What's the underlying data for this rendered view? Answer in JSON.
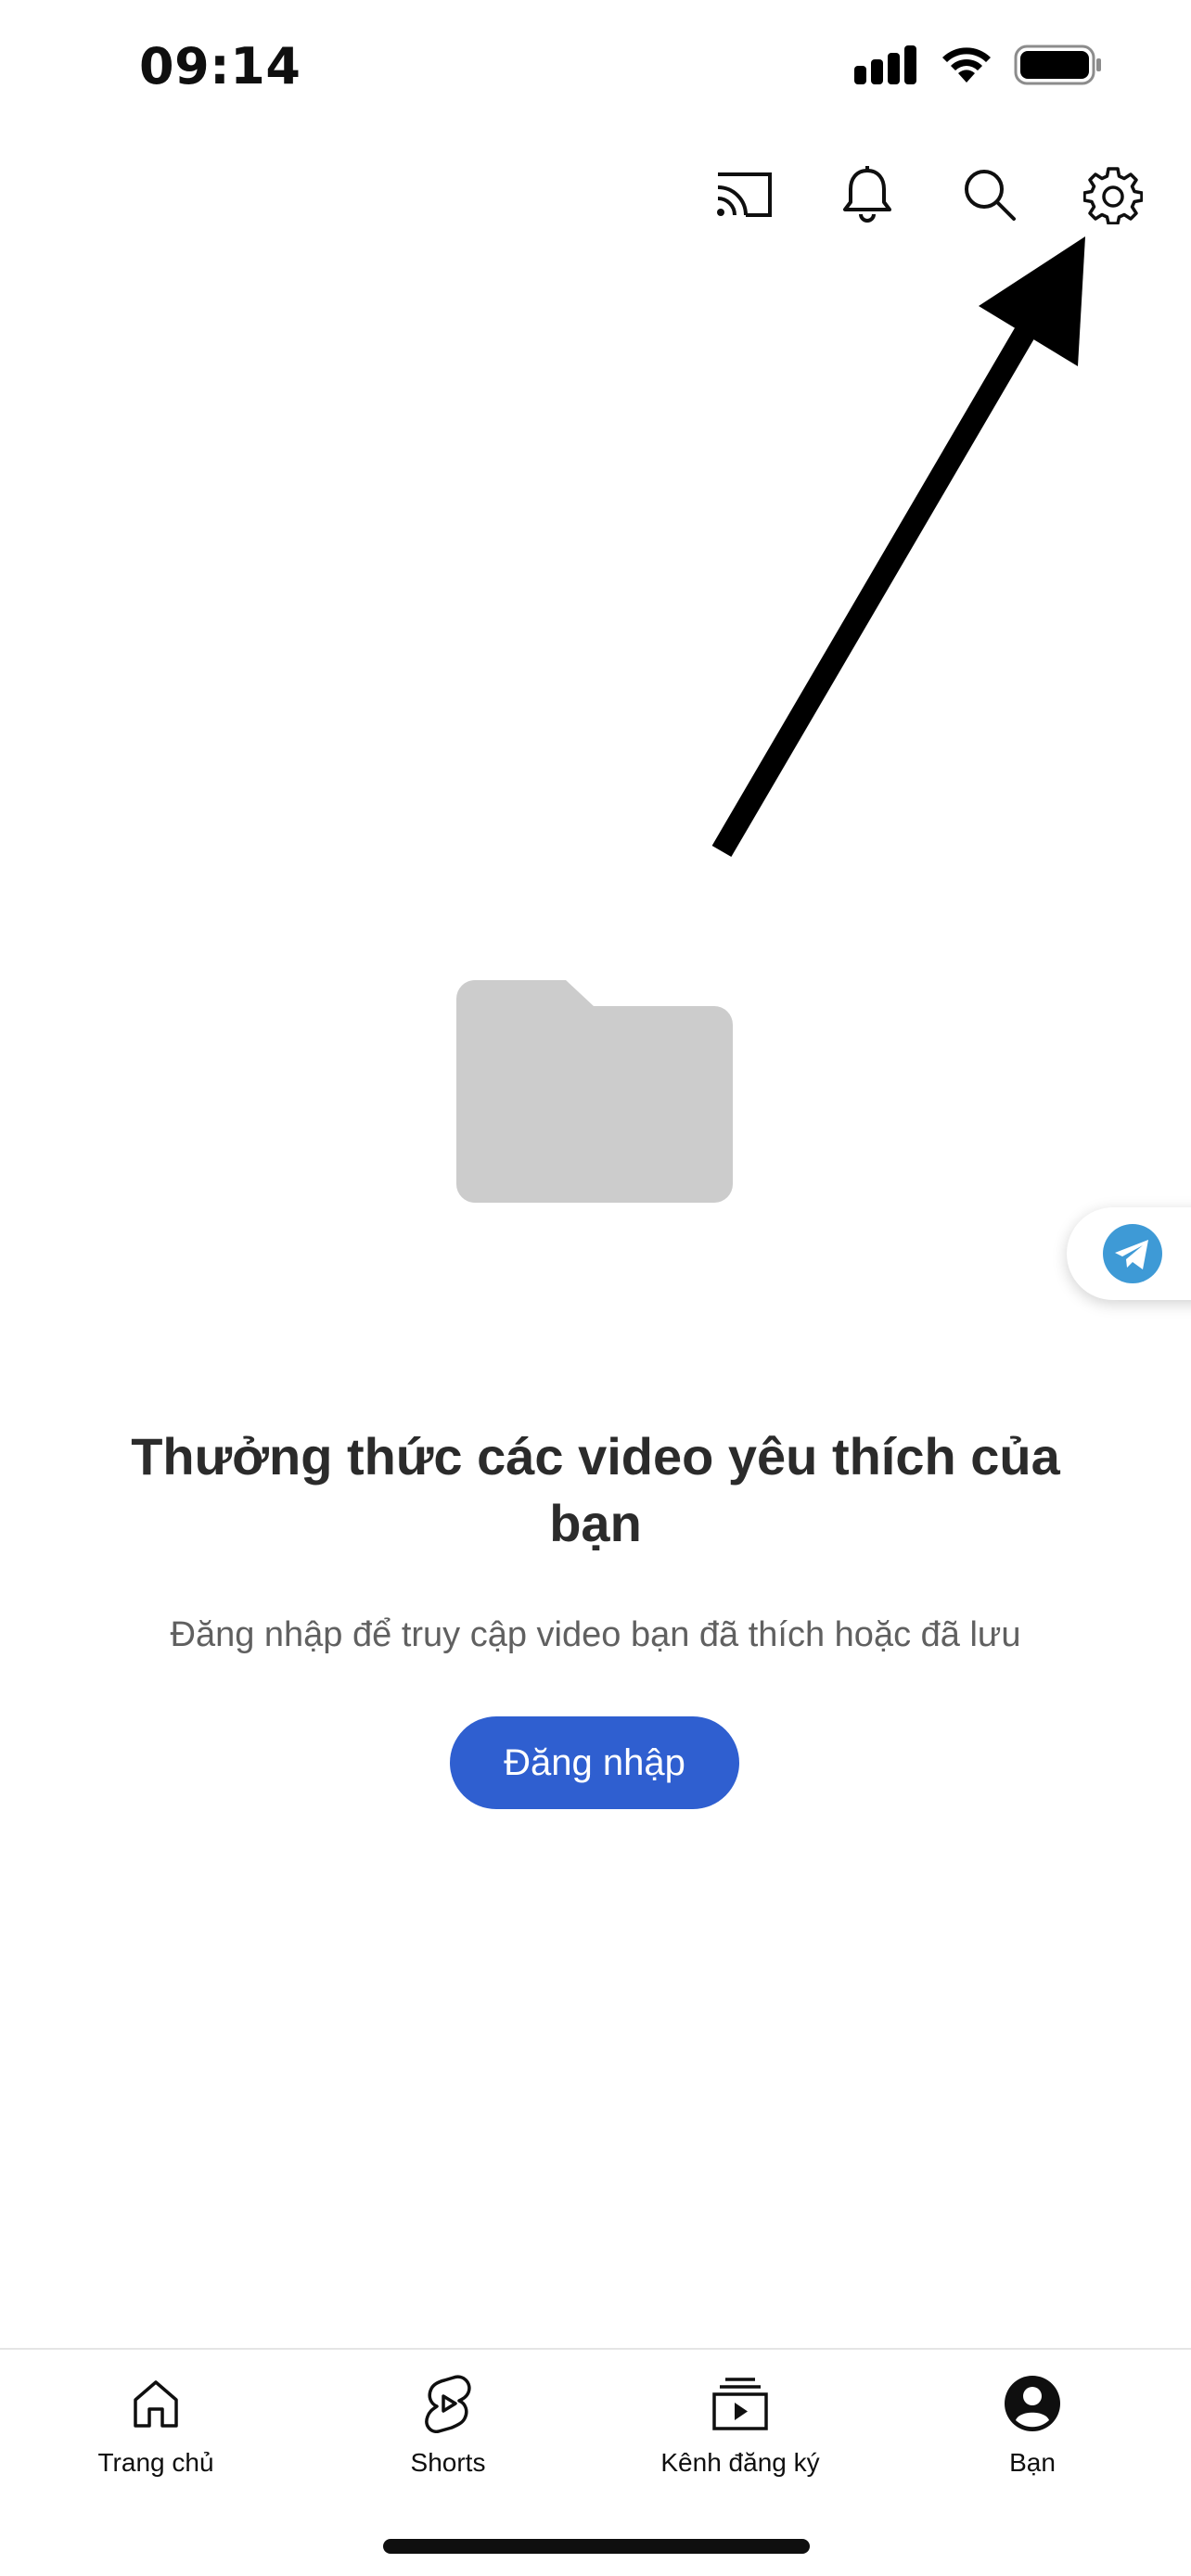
{
  "status_bar": {
    "time": "09:14"
  },
  "top_bar": {
    "icons": [
      "cast-icon",
      "bell-icon",
      "search-icon",
      "gear-icon"
    ]
  },
  "empty_state": {
    "title": "Thưởng thức các video yêu thích của bạn",
    "subtitle": "Đăng nhập để truy cập video bạn đã thích hoặc đã lưu",
    "sign_in_label": "Đăng nhập"
  },
  "bottom_nav": {
    "items": [
      {
        "label": "Trang chủ",
        "icon": "home-icon"
      },
      {
        "label": "Shorts",
        "icon": "shorts-icon"
      },
      {
        "label": "Kênh đăng ký",
        "icon": "subscriptions-icon"
      },
      {
        "label": "Bạn",
        "icon": "account-icon"
      }
    ]
  },
  "colors": {
    "accent": "#2f5fd0",
    "folder": "#cccccc",
    "telegram": "#3e9ad6"
  }
}
